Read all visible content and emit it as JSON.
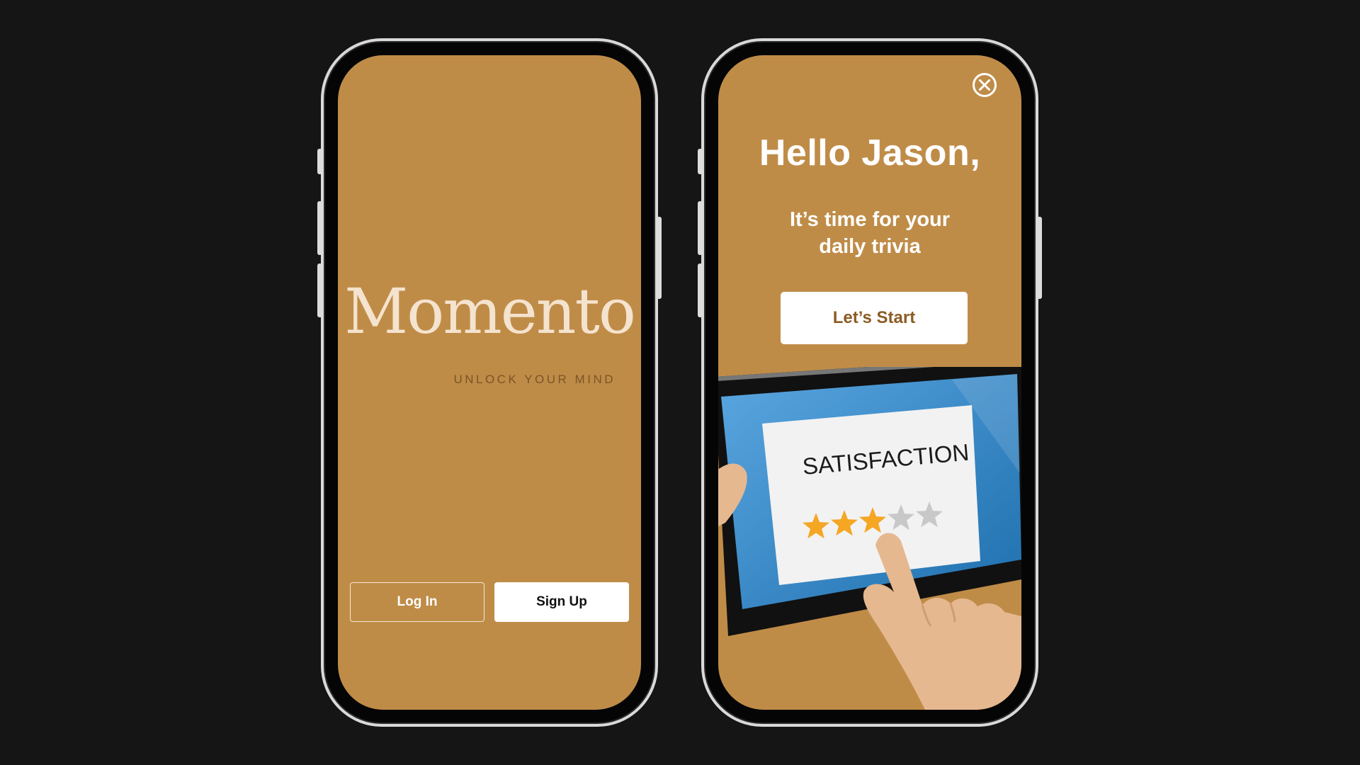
{
  "colors": {
    "background": "#151515",
    "screen": "#bf8c48",
    "logo": "#f4e3ce",
    "tagline": "#7a5427",
    "start_text": "#8c5c23",
    "star_filled": "#f5a623",
    "star_empty": "#c8c8c8",
    "tablet_screen": "#3d8ed0"
  },
  "splash": {
    "logo": "Momento",
    "tagline": "UNLOCK YOUR MIND",
    "login_label": "Log In",
    "signup_label": "Sign Up"
  },
  "trivia": {
    "close_icon": "close-circle-icon",
    "greeting": "Hello Jason,",
    "subtitle": "It’s time for your daily trivia",
    "start_label": "Let’s Start",
    "illustration": {
      "card_text": "SATISFACTION",
      "rating": 3,
      "max_rating": 5
    }
  }
}
